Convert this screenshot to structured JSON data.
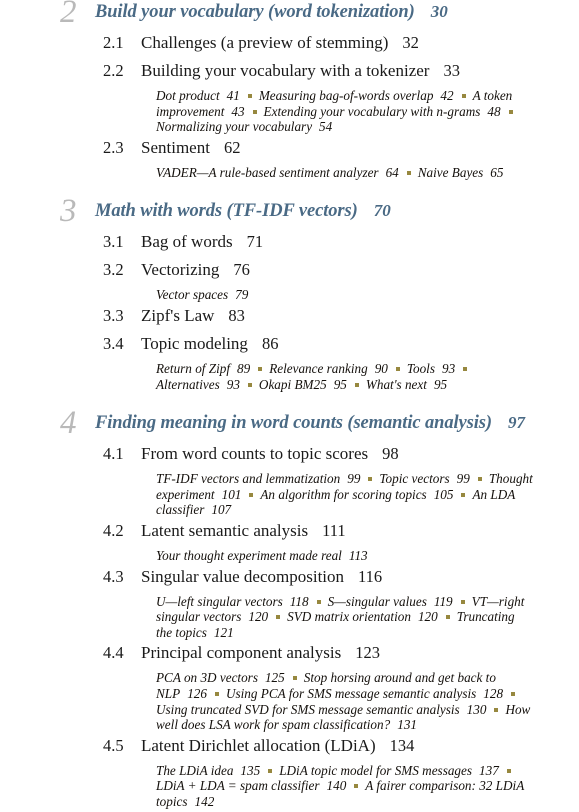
{
  "document": {
    "type": "table-of-contents",
    "colors": {
      "chapter_heading": "#4a6a85",
      "chapter_numeral": "#b9b9b9",
      "separator_bullet": "#97883f",
      "body_text": "#1a1a1a",
      "background": "#ffffff"
    }
  },
  "chapters": [
    {
      "number": "2",
      "title": "Build your vocabulary (word tokenization)",
      "page": "30",
      "sections": [
        {
          "number": "2.1",
          "title": "Challenges (a preview of stemming)",
          "page": "32",
          "topics": []
        },
        {
          "number": "2.2",
          "title": "Building your vocabulary with a tokenizer",
          "page": "33",
          "topics": [
            {
              "name": "Dot product",
              "page": "41"
            },
            {
              "name": "Measuring bag-of-words overlap",
              "page": "42"
            },
            {
              "name": "A token improvement",
              "page": "43"
            },
            {
              "name": "Extending your vocabulary with n-grams",
              "page": "48"
            },
            {
              "name": "Normalizing your vocabulary",
              "page": "54"
            }
          ]
        },
        {
          "number": "2.3",
          "title": "Sentiment",
          "page": "62",
          "topics": [
            {
              "name": "VADER—A rule-based sentiment analyzer",
              "page": "64"
            },
            {
              "name": "Naive Bayes",
              "page": "65"
            }
          ]
        }
      ]
    },
    {
      "number": "3",
      "title": "Math with words (TF-IDF vectors)",
      "page": "70",
      "sections": [
        {
          "number": "3.1",
          "title": "Bag of words",
          "page": "71",
          "topics": []
        },
        {
          "number": "3.2",
          "title": "Vectorizing",
          "page": "76",
          "topics": [
            {
              "name": "Vector spaces",
              "page": "79"
            }
          ]
        },
        {
          "number": "3.3",
          "title": "Zipf's Law",
          "page": "83",
          "topics": []
        },
        {
          "number": "3.4",
          "title": "Topic modeling",
          "page": "86",
          "topics": [
            {
              "name": "Return of Zipf",
              "page": "89"
            },
            {
              "name": "Relevance ranking",
              "page": "90"
            },
            {
              "name": "Tools",
              "page": "93"
            },
            {
              "name": "Alternatives",
              "page": "93"
            },
            {
              "name": "Okapi BM25",
              "page": "95"
            },
            {
              "name": "What's next",
              "page": "95"
            }
          ]
        }
      ]
    },
    {
      "number": "4",
      "title": "Finding meaning in word counts (semantic analysis)",
      "page": "97",
      "sections": [
        {
          "number": "4.1",
          "title": "From word counts to topic scores",
          "page": "98",
          "topics": [
            {
              "name": "TF-IDF vectors and lemmatization",
              "page": "99"
            },
            {
              "name": "Topic vectors",
              "page": "99"
            },
            {
              "name": "Thought experiment",
              "page": "101"
            },
            {
              "name": "An algorithm for scoring topics",
              "page": "105"
            },
            {
              "name": "An LDA classifier",
              "page": "107"
            }
          ]
        },
        {
          "number": "4.2",
          "title": "Latent semantic analysis",
          "page": "111",
          "topics": [
            {
              "name": "Your thought experiment made real",
              "page": "113"
            }
          ]
        },
        {
          "number": "4.3",
          "title": "Singular value decomposition",
          "page": "116",
          "topics": [
            {
              "name": "U—left singular vectors",
              "page": "118"
            },
            {
              "name": "S—singular values",
              "page": "119"
            },
            {
              "name": "VT—right singular vectors",
              "page": "120"
            },
            {
              "name": "SVD matrix orientation",
              "page": "120"
            },
            {
              "name": "Truncating the topics",
              "page": "121"
            }
          ]
        },
        {
          "number": "4.4",
          "title": "Principal component analysis",
          "page": "123",
          "topics": [
            {
              "name": "PCA on 3D vectors",
              "page": "125"
            },
            {
              "name": "Stop horsing around and get back to NLP",
              "page": "126"
            },
            {
              "name": "Using PCA for SMS message semantic analysis",
              "page": "128"
            },
            {
              "name": "Using truncated SVD for SMS message semantic analysis",
              "page": "130"
            },
            {
              "name": "How well does LSA work for spam classification?",
              "page": "131"
            }
          ]
        },
        {
          "number": "4.5",
          "title": "Latent Dirichlet allocation (LDiA)",
          "page": "134",
          "topics": [
            {
              "name": "The LDiA idea",
              "page": "135"
            },
            {
              "name": "LDiA topic model for SMS messages",
              "page": "137"
            },
            {
              "name": "LDiA + LDA = spam classifier",
              "page": "140"
            },
            {
              "name": "A fairer comparison: 32 LDiA topics",
              "page": "142"
            }
          ]
        }
      ]
    }
  ]
}
